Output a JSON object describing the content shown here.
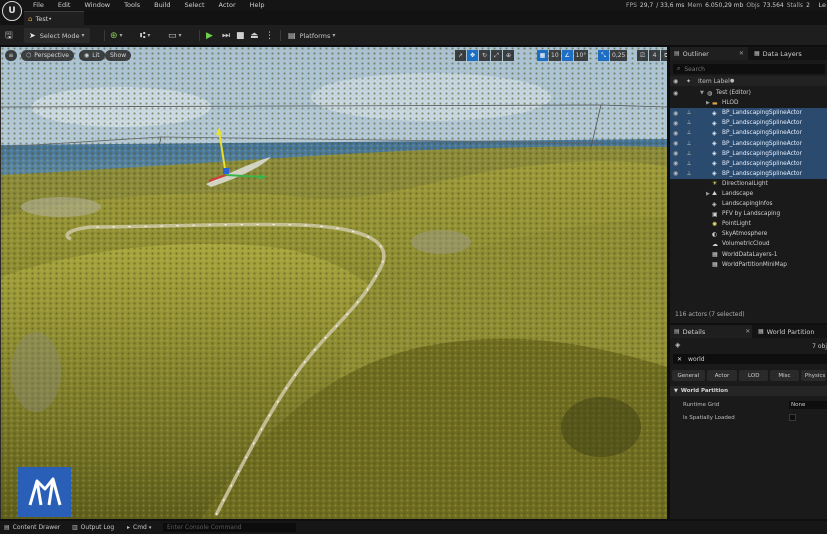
{
  "menu": {
    "items": [
      "File",
      "Edit",
      "Window",
      "Tools",
      "Build",
      "Select",
      "Actor",
      "Help"
    ],
    "stats": {
      "fps_label": "FPS",
      "fps_value": "29,7",
      "ms_value": "/ 33,6 ms",
      "mem_label": "Mem",
      "mem_value": "6.050,29 mb",
      "objs_label": "Objs",
      "objs_value": "73.564",
      "stalls_label": "Stalls",
      "stalls_value": "2"
    },
    "right_cut": "Le"
  },
  "tabs": {
    "level_tab": "Test•"
  },
  "toolbar": {
    "mode_label": "Select Mode",
    "platforms_label": "Platforms"
  },
  "viewport": {
    "perspective": "Perspective",
    "lit": "Lit",
    "show": "Show",
    "grid_snap": "10",
    "rot_snap": "10°",
    "scale_snap": "0,25",
    "camera_speed": "4"
  },
  "outliner": {
    "tab": "Outliner",
    "tab2": "Data Layers",
    "search_placeholder": "Search",
    "column": "Item Label",
    "rows": [
      {
        "label": "Test (Editor)"
      },
      {
        "label": "HLOD"
      },
      {
        "label": "BP_LandscapingSplineActor"
      },
      {
        "label": "BP_LandscapingSplineActor"
      },
      {
        "label": "BP_LandscapingSplineActor"
      },
      {
        "label": "BP_LandscapingSplineActor"
      },
      {
        "label": "BP_LandscapingSplineActor"
      },
      {
        "label": "BP_LandscapingSplineActor"
      },
      {
        "label": "BP_LandscapingSplineActor"
      },
      {
        "label": "DirectionalLight"
      },
      {
        "label": "Landscape"
      },
      {
        "label": "LandscapingInfos"
      },
      {
        "label": "PFV by Landscaping"
      },
      {
        "label": "PointLight"
      },
      {
        "label": "SkyAtmosphere"
      },
      {
        "label": "VolumetricCloud"
      },
      {
        "label": "WorldDataLayers-1"
      },
      {
        "label": "WorldPartitionMiniMap"
      }
    ],
    "count": "116 actors (7 selected)"
  },
  "details": {
    "tab": "Details",
    "tab2": "World Partition",
    "object_count": "7 obj",
    "filter_value": "world",
    "categories": [
      "General",
      "Actor",
      "LOD",
      "Misc",
      "Physics"
    ],
    "section": "World Partition",
    "runtime_grid_label": "Runtime Grid",
    "runtime_grid_value": "None",
    "spatially_loaded_label": "Is Spatially Loaded"
  },
  "statusbar": {
    "content_drawer": "Content Drawer",
    "output_log": "Output Log",
    "cmd": "Cmd",
    "console_placeholder": "Enter Console Command"
  },
  "colors": {
    "selection": "#2a4a6e",
    "accent_blue": "#1e6fc4",
    "play_green": "#6fd04a",
    "brand_blue": "#2a5fb8",
    "forest": "#8b8a2e",
    "sky_top": "#a9c2d6"
  },
  "icons": {
    "save": "save-icon",
    "play": "play-icon",
    "stop": "stop-icon",
    "search": "search-icon",
    "eye": "eye-icon",
    "folder": "folder-icon"
  }
}
